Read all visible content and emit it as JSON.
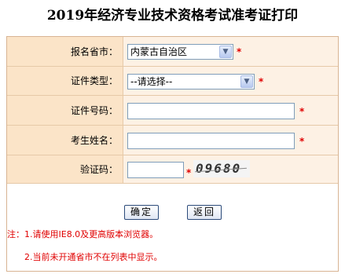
{
  "title": "2019年经济专业技术资格考试准考证打印",
  "form": {
    "province_label": "报名省市：",
    "province_value": "内蒙古自治区",
    "cert_type_label": "证件类型：",
    "cert_type_value": "--请选择--",
    "cert_no_label": "证件号码：",
    "name_label": "考生姓名：",
    "captcha_label": "验证码：",
    "captcha_text": "09680",
    "required_mark": "*"
  },
  "buttons": {
    "confirm": "确定",
    "back": "返回"
  },
  "notes": {
    "line1": "注：1.请使用IE8.0及更高版本浏览器。",
    "line2": "2.当前未开通省市不在列表中显示。"
  },
  "colors": {
    "label_bg": "#fbe4c8",
    "value_bg": "#fdf1e4",
    "required": "#e00000"
  }
}
